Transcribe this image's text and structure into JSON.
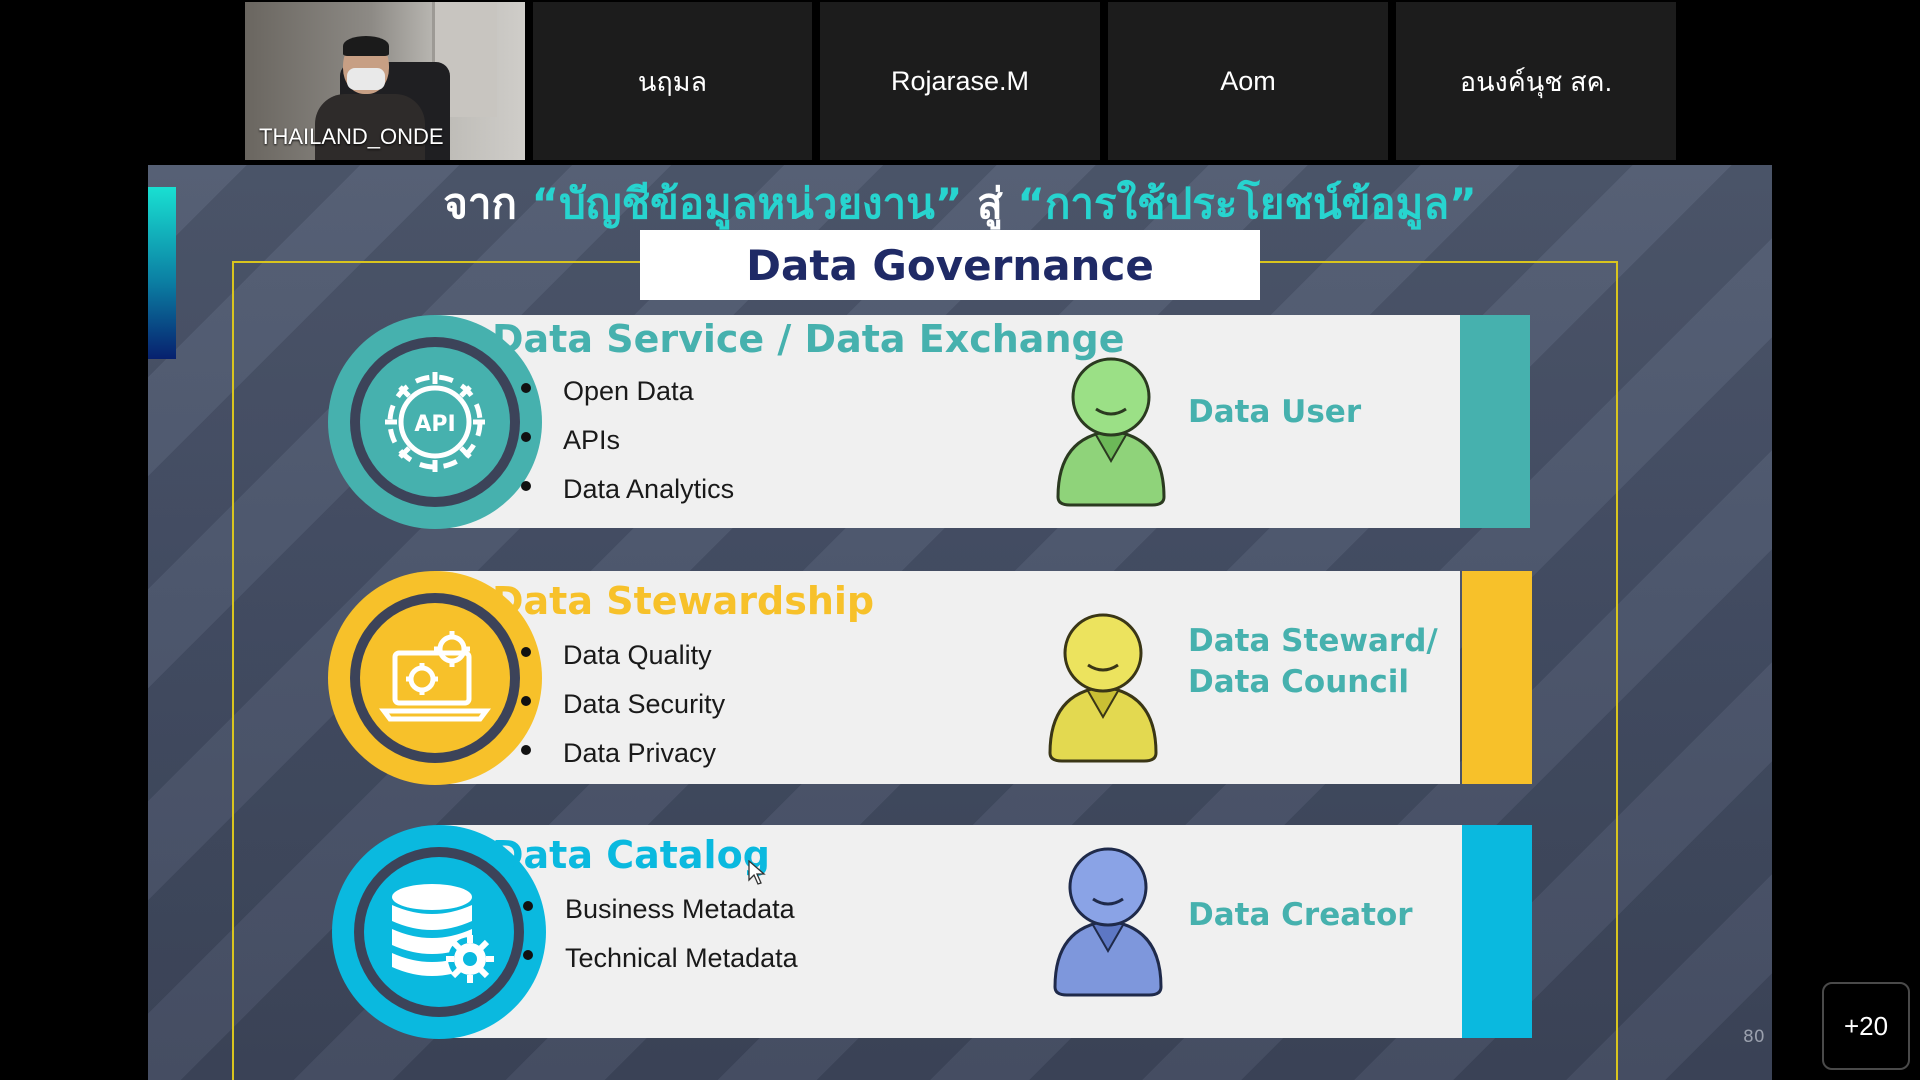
{
  "participants": [
    {
      "name": "THAILAND_ONDE",
      "video": true
    },
    {
      "name": "นฤมล"
    },
    {
      "name": "Rojarase.M"
    },
    {
      "name": "Aom"
    },
    {
      "name": "อนงค์นุช สค."
    }
  ],
  "slide": {
    "title_prefix": "จาก",
    "title_quote_1": "“บัญชีข้อมูลหน่วยงาน”",
    "title_mid": "สู่",
    "title_quote_2": "“การใช้ประโยชน์ข้อมูล”",
    "box_title": "Data Governance",
    "rows": [
      {
        "title": "Data Service / Data Exchange",
        "icon": "api-gear-icon",
        "items": [
          "Open Data",
          "APIs",
          "Data Analytics"
        ],
        "role": "Data User",
        "color": "#46b1ae"
      },
      {
        "title": "Data Stewardship",
        "icon": "laptop-gears-icon",
        "items": [
          "Data Quality",
          "Data Security",
          "Data Privacy"
        ],
        "role_line1": "Data Steward/",
        "role_line2": "Data Council",
        "color": "#f7c12a"
      },
      {
        "title": "Data Catalog",
        "icon": "database-gear-icon",
        "items": [
          "Business Metadata",
          "Technical Metadata"
        ],
        "role": "Data Creator",
        "color": "#0ab9df"
      }
    ],
    "page_number": "80"
  },
  "overflow_button": "+20",
  "colors": {
    "teal": "#46b1ae",
    "yellow": "#f7c12a",
    "cyan": "#0ab9df",
    "title_navy": "#1f2a66"
  }
}
